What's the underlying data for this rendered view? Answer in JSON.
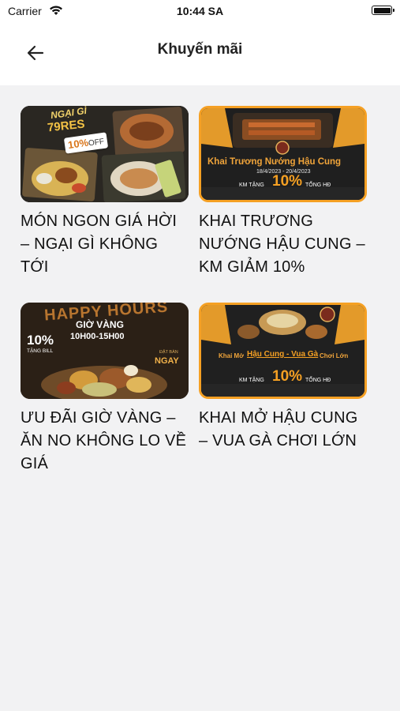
{
  "status_bar": {
    "carrier": "Carrier",
    "time": "10:44 SA"
  },
  "header": {
    "title": "Khuyến mãi",
    "back_icon": "arrow-left-icon"
  },
  "promotions": [
    {
      "title": "MÓN NGON GIÁ HỜI – NGẠI GÌ KHÔNG TỚI",
      "banner": {
        "top_text": "NGẠI GÌ",
        "brand": "79RES",
        "badge_num": "10%",
        "badge_word": "OFF"
      }
    },
    {
      "title": "KHAI TRƯƠNG NƯỚNG HẬU CUNG – KM GIẢM 10%",
      "banner": {
        "headline": "Khai Trương Nướng Hậu Cung",
        "dates": "18/4/2023 - 20/4/2023",
        "left": "KM TẶNG",
        "big": "10%",
        "right": "TỔNG HĐ"
      }
    },
    {
      "title": "ƯU ĐÃI GIỜ VÀNG – ĂN NO KHÔNG LO VỀ GIÁ",
      "banner": {
        "headline": "HAPPY HOURS",
        "sub": "GIỜ VÀNG",
        "hours": "10H00-15H00",
        "pct": "10%",
        "pct_label": "TẶNG BILL",
        "cta_small": "ĐẶT BÀN",
        "cta": "NGAY"
      }
    },
    {
      "title": "KHAI MỞ HẬU CUNG – VUA GÀ CHƠI LỚN",
      "banner": {
        "headline_a": "Khai Mở",
        "headline_b": "Hậu Cung - Vua Gà",
        "headline_c": "Chơi Lớn",
        "left": "KM TẶNG",
        "big": "10%",
        "right": "TỔNG HĐ"
      }
    }
  ],
  "colors": {
    "background": "#f2f2f3",
    "header_bg": "#ffffff",
    "banner_orange": "#f5a023",
    "banner_dark": "#1d1d1d"
  }
}
